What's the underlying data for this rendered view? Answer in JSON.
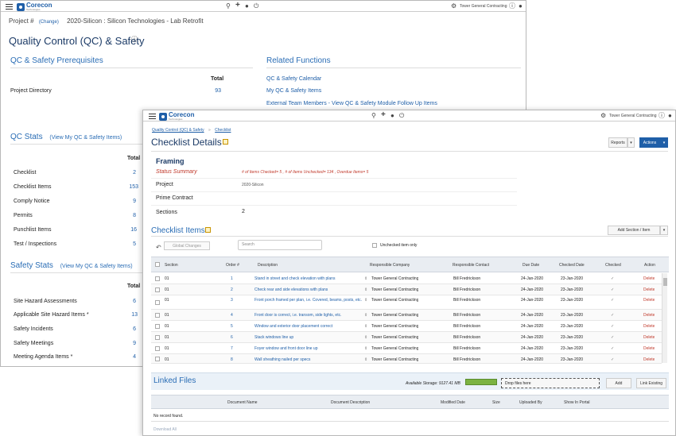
{
  "back": {
    "header": {
      "company": "Tower General Contracting"
    },
    "project_label": "Project #",
    "change_link": "(Change)",
    "project_name": "2020-Silicon : Silicon Technologies - Lab Retrofit",
    "page_title": "Quality Control (QC) & Safety",
    "prereq_title": "QC & Safety Prerequisites",
    "related_title": "Related Functions",
    "total_label": "Total",
    "prereq_rows": [
      {
        "label": "Project Directory",
        "value": "93"
      }
    ],
    "related_links": [
      "QC & Safety Calendar",
      "My QC & Safety Items",
      "External Team Members - View QC & Safety Module Follow Up Items"
    ],
    "qc_stats_title": "QC Stats",
    "qc_stats_link": "(View My QC & Safety Items)",
    "qc_rows": [
      {
        "label": "Checklist",
        "value": "2"
      },
      {
        "label": "Checklist Items",
        "value": "153"
      },
      {
        "label": "Comply Notice",
        "value": "9"
      },
      {
        "label": "Permits",
        "value": "8"
      },
      {
        "label": "Punchlist Items",
        "value": "16"
      },
      {
        "label": "Test / Inspections",
        "value": "5"
      }
    ],
    "safety_title": "Safety Stats",
    "safety_link": "(View My QC & Safety Items)",
    "safety_rows": [
      {
        "label": "Site Hazard Assessments",
        "value": "6"
      },
      {
        "label": "Applicable Site Hazard Items *",
        "value": "13"
      },
      {
        "label": "Safety Incidents",
        "value": "6"
      },
      {
        "label": "Safety Meetings",
        "value": "9"
      },
      {
        "label": "Meeting Agenda Items *",
        "value": "4"
      }
    ]
  },
  "front": {
    "company": "Tower General Contracting",
    "breadcrumb": [
      "Quality Control (QC) & Safety",
      "Checklist"
    ],
    "title": "Checklist Details",
    "reports": "Reports",
    "actions": "Actions",
    "section_title": "Framing",
    "status_label": "Status Summary",
    "status_text": "# of Items Checked= 5 , # of Items Unchecked= 134 , Overdue Items= 5",
    "fields": [
      {
        "label": "Project",
        "value": "2020-Silicon"
      },
      {
        "label": "Prime Contract",
        "value": ""
      },
      {
        "label": "Sections",
        "value": "2"
      }
    ],
    "items_title": "Checklist Items",
    "add_section": "Add Section / Item",
    "global_changes": "Global Changes",
    "search_placeholder": "Search",
    "unchecked_only": "Unchecked item only",
    "columns": [
      "Section",
      "Order #",
      "Description",
      "Responsible Company",
      "Responsible Contact",
      "Due Date",
      "Checked Date",
      "Checked",
      "Action"
    ],
    "rows": [
      {
        "section": "01",
        "order": "1",
        "desc": "Stand in street and check elevation with plans",
        "company": "Tower General Contracting",
        "contact": "Bill Fredrickson",
        "due": "24-Jan-2020",
        "checked_date": "23-Jan-2020",
        "action": "Delete"
      },
      {
        "section": "01",
        "order": "2",
        "desc": "Check rear and side elevations with plans",
        "company": "Tower General Contracting",
        "contact": "Bill Fredrickson",
        "due": "24-Jan-2020",
        "checked_date": "23-Jan-2020",
        "action": "Delete"
      },
      {
        "section": "01",
        "order": "3",
        "desc": "Front porch framed per plan, i.e. Covered, beams, posts, etc.",
        "company": "Tower General Contracting",
        "contact": "Bill Fredrickson",
        "due": "24-Jan-2020",
        "checked_date": "23-Jan-2020",
        "action": "Delete"
      },
      {
        "section": "01",
        "order": "4",
        "desc": "Front door is correct, i.e. transom, side lights, etc.",
        "company": "Tower General Contracting",
        "contact": "Bill Fredrickson",
        "due": "24-Jan-2020",
        "checked_date": "23-Jan-2020",
        "action": "Delete"
      },
      {
        "section": "01",
        "order": "5",
        "desc": "Window and exterior door placement correct",
        "company": "Tower General Contracting",
        "contact": "Bill Fredrickson",
        "due": "24-Jan-2020",
        "checked_date": "23-Jan-2020",
        "action": "Delete"
      },
      {
        "section": "01",
        "order": "6",
        "desc": "Stack windows line up",
        "company": "Tower General Contracting",
        "contact": "Bill Fredrickson",
        "due": "24-Jan-2020",
        "checked_date": "23-Jan-2020",
        "action": "Delete"
      },
      {
        "section": "01",
        "order": "7",
        "desc": "Foyer window and front door line up",
        "company": "Tower General Contracting",
        "contact": "Bill Fredrickson",
        "due": "24-Jan-2020",
        "checked_date": "23-Jan-2020",
        "action": "Delete"
      },
      {
        "section": "01",
        "order": "8",
        "desc": "Wall sheathing nailed per specs",
        "company": "Tower General Contracting",
        "contact": "Bill Fredrickson",
        "due": "24-Jan-2020",
        "checked_date": "23-Jan-2020",
        "action": "Delete"
      }
    ],
    "linked_title": "Linked Files",
    "storage": "Available Storage: 9127.41 MB",
    "drop": "Drop files here",
    "add": "Add",
    "link_existing": "Link Existing",
    "file_columns": [
      "Document Name",
      "Document Description",
      "Modified Date",
      "Size",
      "Uploaded By",
      "Show In Portal"
    ],
    "no_record": "No record found.",
    "download_all": "Download All"
  }
}
